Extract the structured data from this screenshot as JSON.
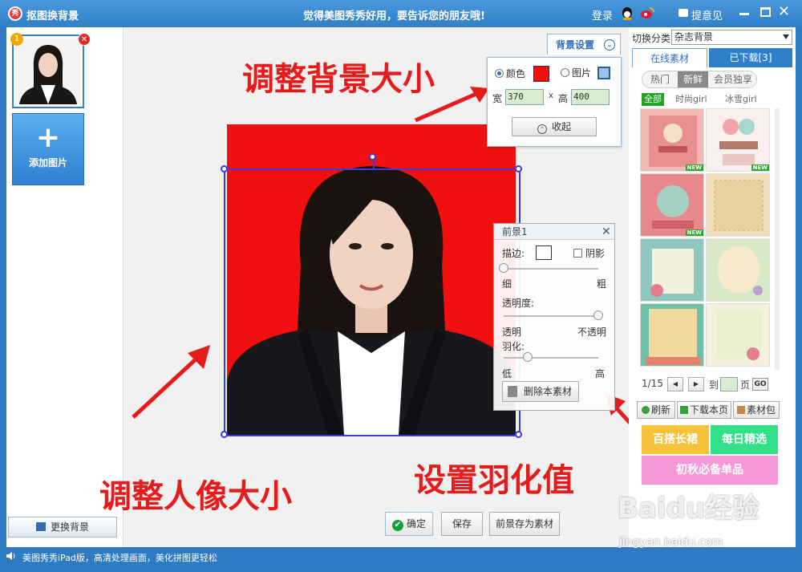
{
  "window": {
    "title": "抠图换背景",
    "logo_text": "秀",
    "slogan": "觉得美图秀秀好用，要告诉您的朋友哦!",
    "login": "登录",
    "feedback": "提意见",
    "close_glyph": "✕"
  },
  "left": {
    "thumb_index": "1",
    "thumb_delete_glyph": "✕",
    "add_plus": "+",
    "add_label": "添加图片",
    "change_bg_label": "更换背景"
  },
  "annotations": {
    "resize_background": "调整背景大小",
    "resize_portrait": "调整人像大小",
    "set_feather": "设置羽化值",
    "color": "#e61c1c"
  },
  "bg_settings": {
    "tab_label": "背景设置",
    "tab_chevron": "⌄",
    "color_option": "颜色",
    "image_option": "图片",
    "selected": "color",
    "color_value": "#f01010",
    "width_label": "宽",
    "width_value": "370",
    "times": "x",
    "height_label": "高",
    "height_value": "400",
    "collapse_icon": "⌃",
    "collapse_label": "收起"
  },
  "foreground_panel": {
    "title": "前景1",
    "close_glyph": "✕",
    "stroke_label": "描边:",
    "shadow_label": "阴影",
    "shadow_checked": false,
    "thin_label": "细",
    "thick_label": "粗",
    "stroke_value": 0,
    "opacity_label": "透明度:",
    "transparent_label": "透明",
    "opaque_label": "不透明",
    "opacity_value": 1.0,
    "feather_label": "羽化:",
    "low_label": "低",
    "high_label": "高",
    "feather_value": 0.25,
    "delete_label": "删除本素材"
  },
  "bottom_buttons": {
    "ok_icon": "✔",
    "ok_label": "确定",
    "save_label": "保存",
    "save_fg_label": "前景存为素材"
  },
  "right": {
    "category_label": "切换分类",
    "category_value": "杂志背景",
    "tab_online": "在线素材",
    "tab_downloaded": "已下载[3]",
    "filters": [
      "热门",
      "新鲜",
      "会员独享"
    ],
    "active_filter": "新鲜",
    "tags": [
      "全部",
      "时尚girl",
      "冰雪girl"
    ],
    "new_badge": "NEW",
    "page_info": "1/15",
    "prev_glyph": "◀",
    "next_glyph": "▶",
    "goto_label": "到",
    "page_unit": "页",
    "go_label": "GO",
    "refresh_label": "刷新",
    "download_page_label": "下载本页",
    "pack_label": "素材包",
    "promo1": "百搭长裙",
    "promo2": "每日精选",
    "promo3": "初秋必备单品",
    "promo1_color": "#f6c23a",
    "promo2_color": "#33e08a",
    "promo3_color": "#f59ad6"
  },
  "status": {
    "text": "美图秀秀iPad版，高清处理画面，美化拼图更轻松"
  },
  "watermark": {
    "brand": "Baidu经验",
    "url": "jingyan.baidu.com"
  }
}
